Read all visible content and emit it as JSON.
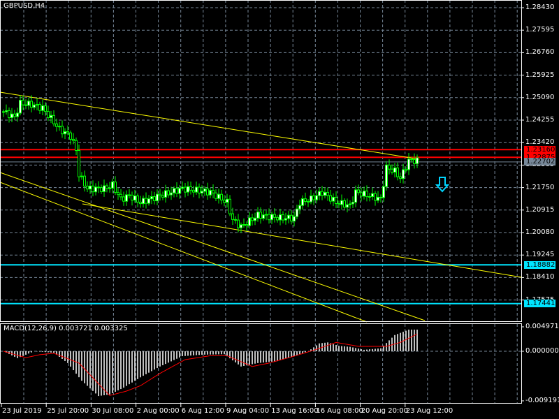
{
  "header": {
    "symbol_title": "GBPUSD,H4"
  },
  "price_axis": {
    "ticks": [
      "1.28430",
      "1.27595",
      "1.26760",
      "1.25925",
      "1.25090",
      "1.24255",
      "1.23420",
      "1.22585",
      "1.21750",
      "1.20915",
      "1.20080",
      "1.19245",
      "1.18410",
      "1.17575"
    ],
    "tick_values": [
      1.2843,
      1.27595,
      1.2676,
      1.25925,
      1.2509,
      1.24255,
      1.2342,
      1.22585,
      1.2175,
      1.20915,
      1.2008,
      1.19245,
      1.1841,
      1.17575
    ]
  },
  "levels": [
    {
      "label": "1.23160",
      "value": 1.2316,
      "color": "#ff0000"
    },
    {
      "label": "1.22875",
      "value": 1.22875,
      "color": "#ff0000"
    },
    {
      "label": "1.22702",
      "value": 1.22702,
      "color": "#778899"
    },
    {
      "label": "1.18882",
      "value": 1.18882,
      "color": "#00e5ff"
    },
    {
      "label": "1.17441",
      "value": 1.17441,
      "color": "#00e5ff"
    }
  ],
  "time_axis": [
    "23 Jul 2019",
    "25 Jul 20:00",
    "30 Jul 08:00",
    "2 Aug 00:00",
    "6 Aug 12:00",
    "9 Aug 04:00",
    "13 Aug 16:00",
    "16 Aug 08:00",
    "20 Aug 20:00",
    "23 Aug 12:00"
  ],
  "macd": {
    "title": "MACD(12,26,9) 0.003721 0.003325",
    "ticks": [
      "0.004971",
      "0.000000",
      "-0.009191"
    ],
    "tick_values": [
      0.004971,
      0,
      -0.009191
    ]
  },
  "icons": {
    "sell_arrow": "down-arrow-icon"
  },
  "colors": {
    "bull": "#00ff00",
    "grid": "#778899",
    "trend": "#ffff00",
    "signal": "#ff0000",
    "hist": "#c0c0c0"
  },
  "chart_data": {
    "type": "candlestick",
    "bars": 149,
    "price_keypoints": [
      [
        0,
        1.2457
      ],
      [
        4,
        1.2436
      ],
      [
        6,
        1.2488
      ],
      [
        10,
        1.2483
      ],
      [
        14,
        1.247
      ],
      [
        16,
        1.2444
      ],
      [
        20,
        1.2392
      ],
      [
        24,
        1.2366
      ],
      [
        26,
        1.2314
      ],
      [
        27,
        1.2223
      ],
      [
        30,
        1.2171
      ],
      [
        36,
        1.2171
      ],
      [
        39,
        1.2184
      ],
      [
        42,
        1.2132
      ],
      [
        45,
        1.2145
      ],
      [
        49,
        1.212
      ],
      [
        56,
        1.2145
      ],
      [
        64,
        1.2171
      ],
      [
        74,
        1.2158
      ],
      [
        80,
        1.212
      ],
      [
        82,
        1.2055
      ],
      [
        85,
        1.2029
      ],
      [
        91,
        1.2073
      ],
      [
        99,
        1.2062
      ],
      [
        104,
        1.2062
      ],
      [
        106,
        1.212
      ],
      [
        110,
        1.2132
      ],
      [
        114,
        1.2158
      ],
      [
        119,
        1.212
      ],
      [
        124,
        1.2107
      ],
      [
        126,
        1.2158
      ],
      [
        131,
        1.2145
      ],
      [
        135,
        1.2132
      ],
      [
        137,
        1.2249
      ],
      [
        140,
        1.2236
      ],
      [
        142,
        1.221
      ],
      [
        145,
        1.2275
      ],
      [
        148,
        1.2275
      ]
    ],
    "macd_hist_keypoints": [
      [
        0,
        0
      ],
      [
        5,
        -0.0014
      ],
      [
        11,
        0
      ],
      [
        18,
        -0.0003
      ],
      [
        23,
        -0.0024
      ],
      [
        28,
        -0.006
      ],
      [
        34,
        -0.0091
      ],
      [
        38,
        -0.0088
      ],
      [
        43,
        -0.0074
      ],
      [
        49,
        -0.0053
      ],
      [
        56,
        -0.0031
      ],
      [
        64,
        -0.001
      ],
      [
        71,
        -0.0007
      ],
      [
        79,
        -0.0006
      ],
      [
        85,
        -0.0031
      ],
      [
        91,
        -0.0024
      ],
      [
        98,
        -0.002
      ],
      [
        104,
        -0.001
      ],
      [
        109,
        0
      ],
      [
        113,
        0.0016
      ],
      [
        116,
        0.0018
      ],
      [
        120,
        0.0011
      ],
      [
        124,
        0.0009
      ],
      [
        129,
        0.0003
      ],
      [
        135,
        0.0006
      ],
      [
        140,
        0.0033
      ],
      [
        145,
        0.0044
      ],
      [
        149,
        0.0044
      ]
    ],
    "macd_signal_keypoints": [
      [
        0,
        0
      ],
      [
        8,
        -0.0013
      ],
      [
        13,
        -0.0007
      ],
      [
        18,
        -0.0004
      ],
      [
        27,
        -0.0024
      ],
      [
        33,
        -0.006
      ],
      [
        38,
        -0.009
      ],
      [
        44,
        -0.0081
      ],
      [
        49,
        -0.007
      ],
      [
        56,
        -0.0045
      ],
      [
        65,
        -0.0017
      ],
      [
        74,
        -0.0009
      ],
      [
        80,
        -0.0009
      ],
      [
        89,
        -0.0031
      ],
      [
        95,
        -0.0024
      ],
      [
        104,
        -0.001
      ],
      [
        112,
        0.0004
      ],
      [
        119,
        0.0018
      ],
      [
        127,
        0.001
      ],
      [
        137,
        0.001
      ],
      [
        142,
        0.0018
      ],
      [
        149,
        0.0038
      ]
    ]
  }
}
